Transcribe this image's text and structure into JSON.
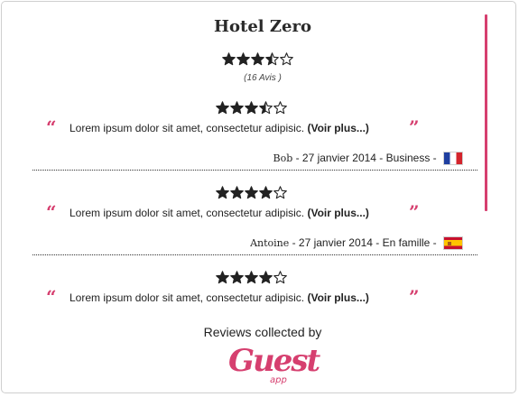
{
  "hotel": {
    "name": "Hotel Zero",
    "rating": 3.5,
    "max_rating": 5,
    "review_count": "(16 Avis )"
  },
  "reviews": [
    {
      "rating": 3.5,
      "text": "Lorem ipsum dolor sit amet, consectetur adipisic.",
      "more_label": "(Voir plus...)",
      "author": "Bob",
      "details": " - 27 janvier 2014 - Business - ",
      "flag": "flag-france-icon"
    },
    {
      "rating": 4,
      "text": "Lorem ipsum dolor sit amet, consectetur adipisic.",
      "more_label": "(Voir plus...)",
      "author": "Antoine",
      "details": " - 27 janvier 2014 - En famille - ",
      "flag": "flag-spain-icon"
    },
    {
      "rating": 4,
      "text": "Lorem ipsum dolor sit amet, consectetur adipisic.",
      "more_label": "(Voir plus...)"
    }
  ],
  "quote_open": "“",
  "quote_close": "”",
  "footer": {
    "collected_by": "Reviews collected by",
    "logo_word": "Guest",
    "logo_sub": "app"
  },
  "colors": {
    "accent": "#d63f6f",
    "star": "#222222",
    "text": "#222222"
  }
}
